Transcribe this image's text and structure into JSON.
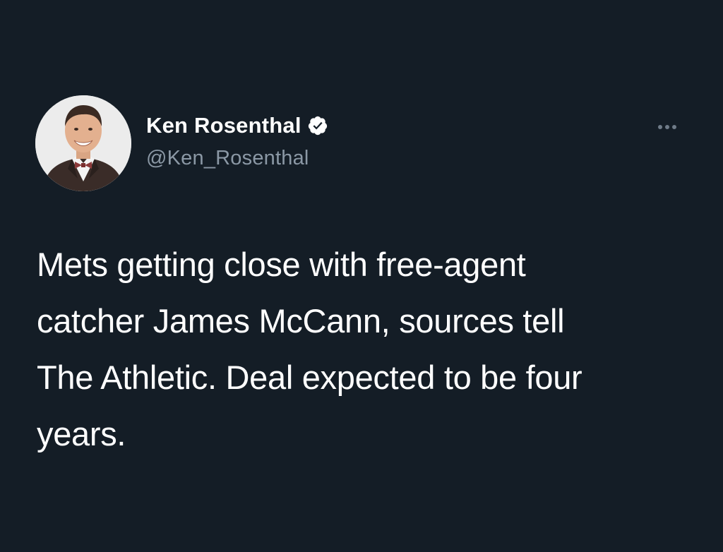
{
  "tweet": {
    "author": {
      "display_name": "Ken Rosenthal",
      "handle": "@Ken_Rosenthal",
      "verified": true,
      "avatar_icon": "profile-photo"
    },
    "more_icon": "ellipsis-icon",
    "text": "Mets getting close with free-agent\ncatcher James McCann, sources tell\nThe Athletic. Deal expected to be four\nyears."
  },
  "colors": {
    "background": "#141d26",
    "text_primary": "#ffffff",
    "text_secondary": "#8b98a5",
    "verified_badge": "#ffffff"
  }
}
